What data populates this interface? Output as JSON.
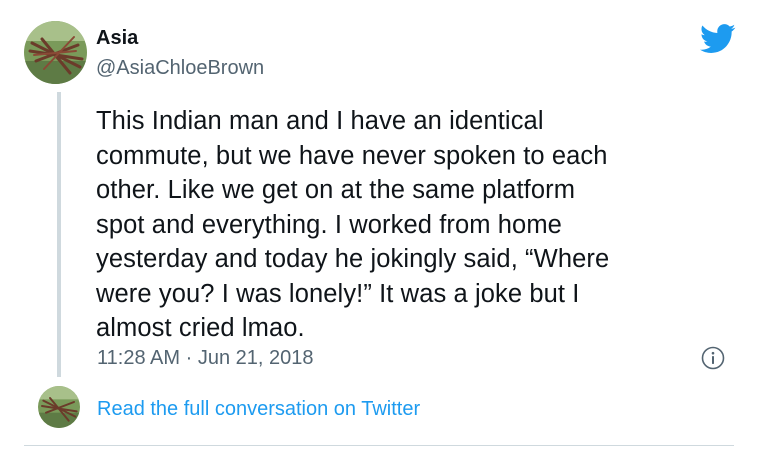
{
  "author": {
    "display_name": "Asia",
    "handle": "@AsiaChloeBrown",
    "avatar_icon": "avatar-photo"
  },
  "brand": {
    "icon": "twitter-bird-icon",
    "color": "#1d9bf0"
  },
  "tweet": {
    "lines": [
      "This Indian man and I have an identical",
      "commute, but we have never spoken to each",
      "other. Like we get on at the same platform",
      "spot and everything. I worked from home",
      "yesterday and today he jokingly said, “Where",
      "were you? I was lonely!” It was a joke but I",
      "almost cried lmao."
    ],
    "time": "11:28 AM",
    "separator": "·",
    "date": "Jun 21, 2018",
    "info_icon": "info-icon"
  },
  "footer": {
    "link_label": "Read the full conversation on Twitter"
  }
}
